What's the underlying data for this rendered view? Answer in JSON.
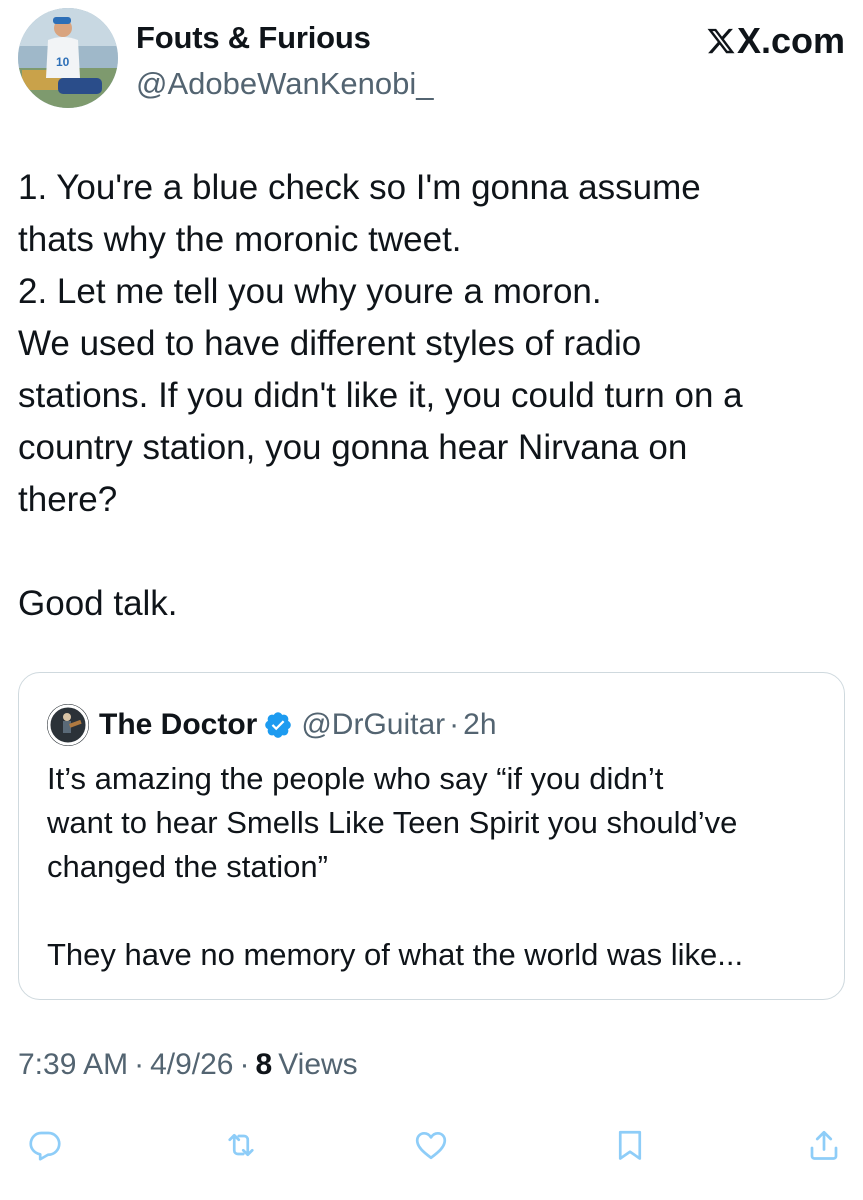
{
  "tweet": {
    "author": {
      "display_name": "Fouts & Furious",
      "handle": "@AdobeWanKenobi_",
      "avatar_jersey_number": "10"
    },
    "brand": "X.com",
    "text": "1. You're a blue check so I'm gonna assume\nthats why the moronic tweet.\n2. Let me tell you why youre a moron.\nWe used to have different styles of radio\nstations. If you didn't like it, you could turn on a\ncountry station, you gonna hear Nirvana on\nthere?\n\nGood talk.",
    "quoted": {
      "display_name": "The Doctor",
      "handle": "@DrGuitar",
      "separator": "·",
      "time": "2h",
      "text": "It’s amazing the people who say “if you didn’t\nwant to hear Smells Like Teen Spirit you should’ve\nchanged the station”\n\nThey have no memory of what the world was like..."
    },
    "meta": {
      "time": "7:39 AM",
      "separator": "·",
      "date": "4/9/26",
      "views_count": "8",
      "views_label": "Views"
    },
    "actions": [
      {
        "name": "reply",
        "icon": "reply-icon"
      },
      {
        "name": "retweet",
        "icon": "retweet-icon"
      },
      {
        "name": "like",
        "icon": "heart-icon"
      },
      {
        "name": "bookmark",
        "icon": "bookmark-icon"
      },
      {
        "name": "share",
        "icon": "share-icon"
      }
    ],
    "colors": {
      "text": "#0f1419",
      "secondary": "#536471",
      "verified": "#1d9bf0",
      "action_icon": "#8ecdf8",
      "border": "#cfd9de"
    }
  }
}
